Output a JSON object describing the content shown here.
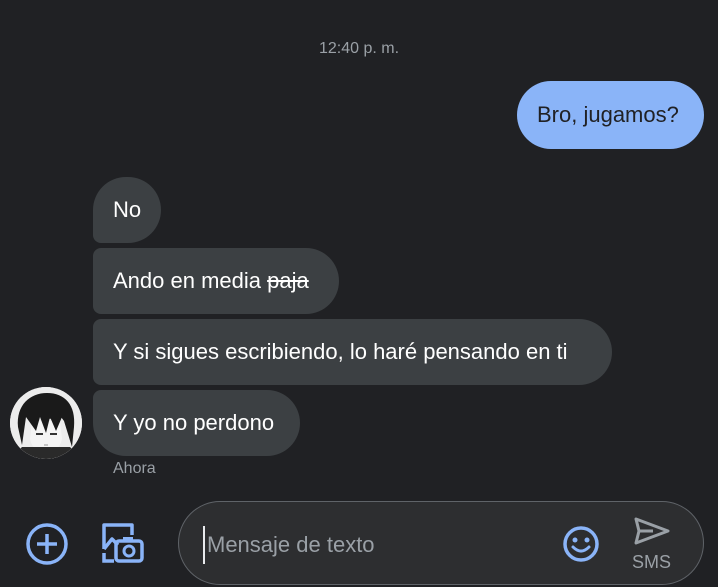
{
  "conversation": {
    "timestamp": "12:40 p. m.",
    "outgoing": [
      {
        "text": "Bro, jugamos?"
      }
    ],
    "incoming": [
      {
        "text": "No"
      },
      {
        "text_before": "Ando en media ",
        "text_struck": "paja"
      },
      {
        "text": "Y si sigues escribiendo, lo haré pensando en ti"
      },
      {
        "text": "Y yo no perdono"
      }
    ],
    "last_seen": "Ahora"
  },
  "composer": {
    "placeholder": "Mensaje de texto",
    "send_label": "SMS"
  },
  "icons": {
    "add": "add-circle-icon",
    "gallery": "gallery-camera-icon",
    "emoji": "emoji-icon",
    "send": "send-icon"
  },
  "colors": {
    "background": "#202124",
    "outgoing_bubble": "#8ab4f8",
    "incoming_bubble": "#3c4043",
    "accent": "#8ab4f8"
  }
}
